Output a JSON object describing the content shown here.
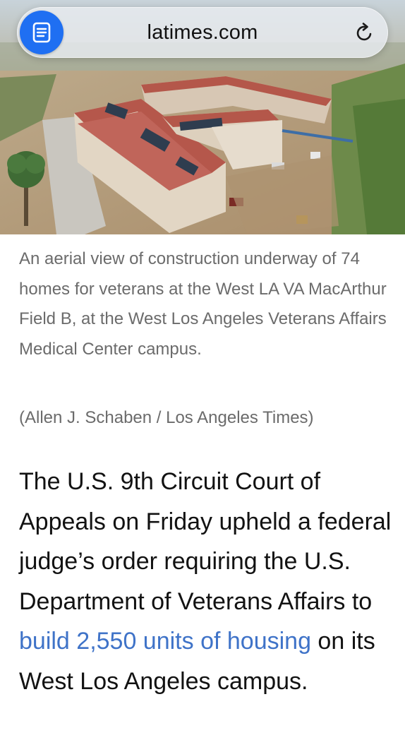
{
  "browser": {
    "url": "latimes.com",
    "reader_icon": "reader-view-icon",
    "reload_icon": "reload-icon"
  },
  "hero_image": {
    "subject": "aerial-construction-photo"
  },
  "caption": {
    "text": "An aerial view of construction underway of 74 homes for veterans at the West LA VA MacArthur Field B, at the West Los Angeles Veterans Affairs Medical Center campus.",
    "credit": "(Allen J. Schaben / Los Angeles Times)"
  },
  "article": {
    "part1": "The U.S. 9th Circuit Court of Appeals on Friday upheld a federal judge’s order requiring the U.S. Department of Veterans Affairs to ",
    "link_text": "build 2,550 units of housing",
    "part2": " on its West Los Angeles campus."
  },
  "colors": {
    "link": "#3f73c8",
    "reader_button": "#1f6ff2",
    "caption_text": "#6b6b6b",
    "body_text": "#121212"
  }
}
